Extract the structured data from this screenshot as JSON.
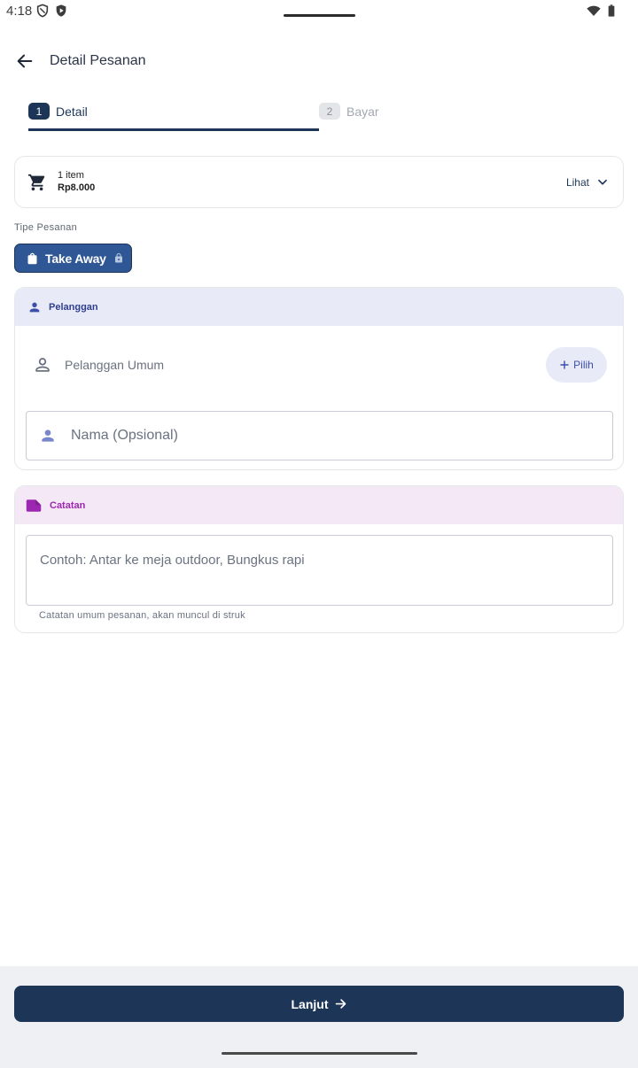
{
  "status_bar": {
    "time": "4:18"
  },
  "header": {
    "title": "Detail Pesanan"
  },
  "stepper": {
    "steps": [
      {
        "number": "1",
        "label": "Detail",
        "active": true
      },
      {
        "number": "2",
        "label": "Bayar",
        "active": false
      }
    ]
  },
  "cart": {
    "count_text": "1 item",
    "total_text": "Rp8.000",
    "see_label": "Lihat"
  },
  "order_type": {
    "label": "Tipe Pesanan",
    "selected": "Take Away"
  },
  "customer": {
    "title": "Pelanggan",
    "current": "Pelanggan Umum",
    "pick_label": "Pilih",
    "name_placeholder": "Nama (Opsional)"
  },
  "note": {
    "title": "Catatan",
    "placeholder": "Contoh: Antar ke meja outdoor, Bungkus rapi",
    "helper": "Catatan umum pesanan, akan muncul di struk"
  },
  "footer": {
    "next_label": "Lanjut"
  },
  "colors": {
    "primary": "#1d3557",
    "chip": "#2f5796",
    "customer_accent": "#3b4ea8",
    "note_accent": "#9c27b0"
  },
  "icons": {
    "status": [
      "shield-icon",
      "play-shield-icon",
      "wifi-icon",
      "battery-icon"
    ],
    "back": "arrow-left-icon",
    "cart": "cart-icon",
    "expand": "chevron-down-icon",
    "bag": "shopping-bag-icon",
    "lock": "lock-icon",
    "person": "person-icon",
    "add": "plus-icon",
    "note": "label-icon",
    "next": "arrow-right-icon"
  }
}
